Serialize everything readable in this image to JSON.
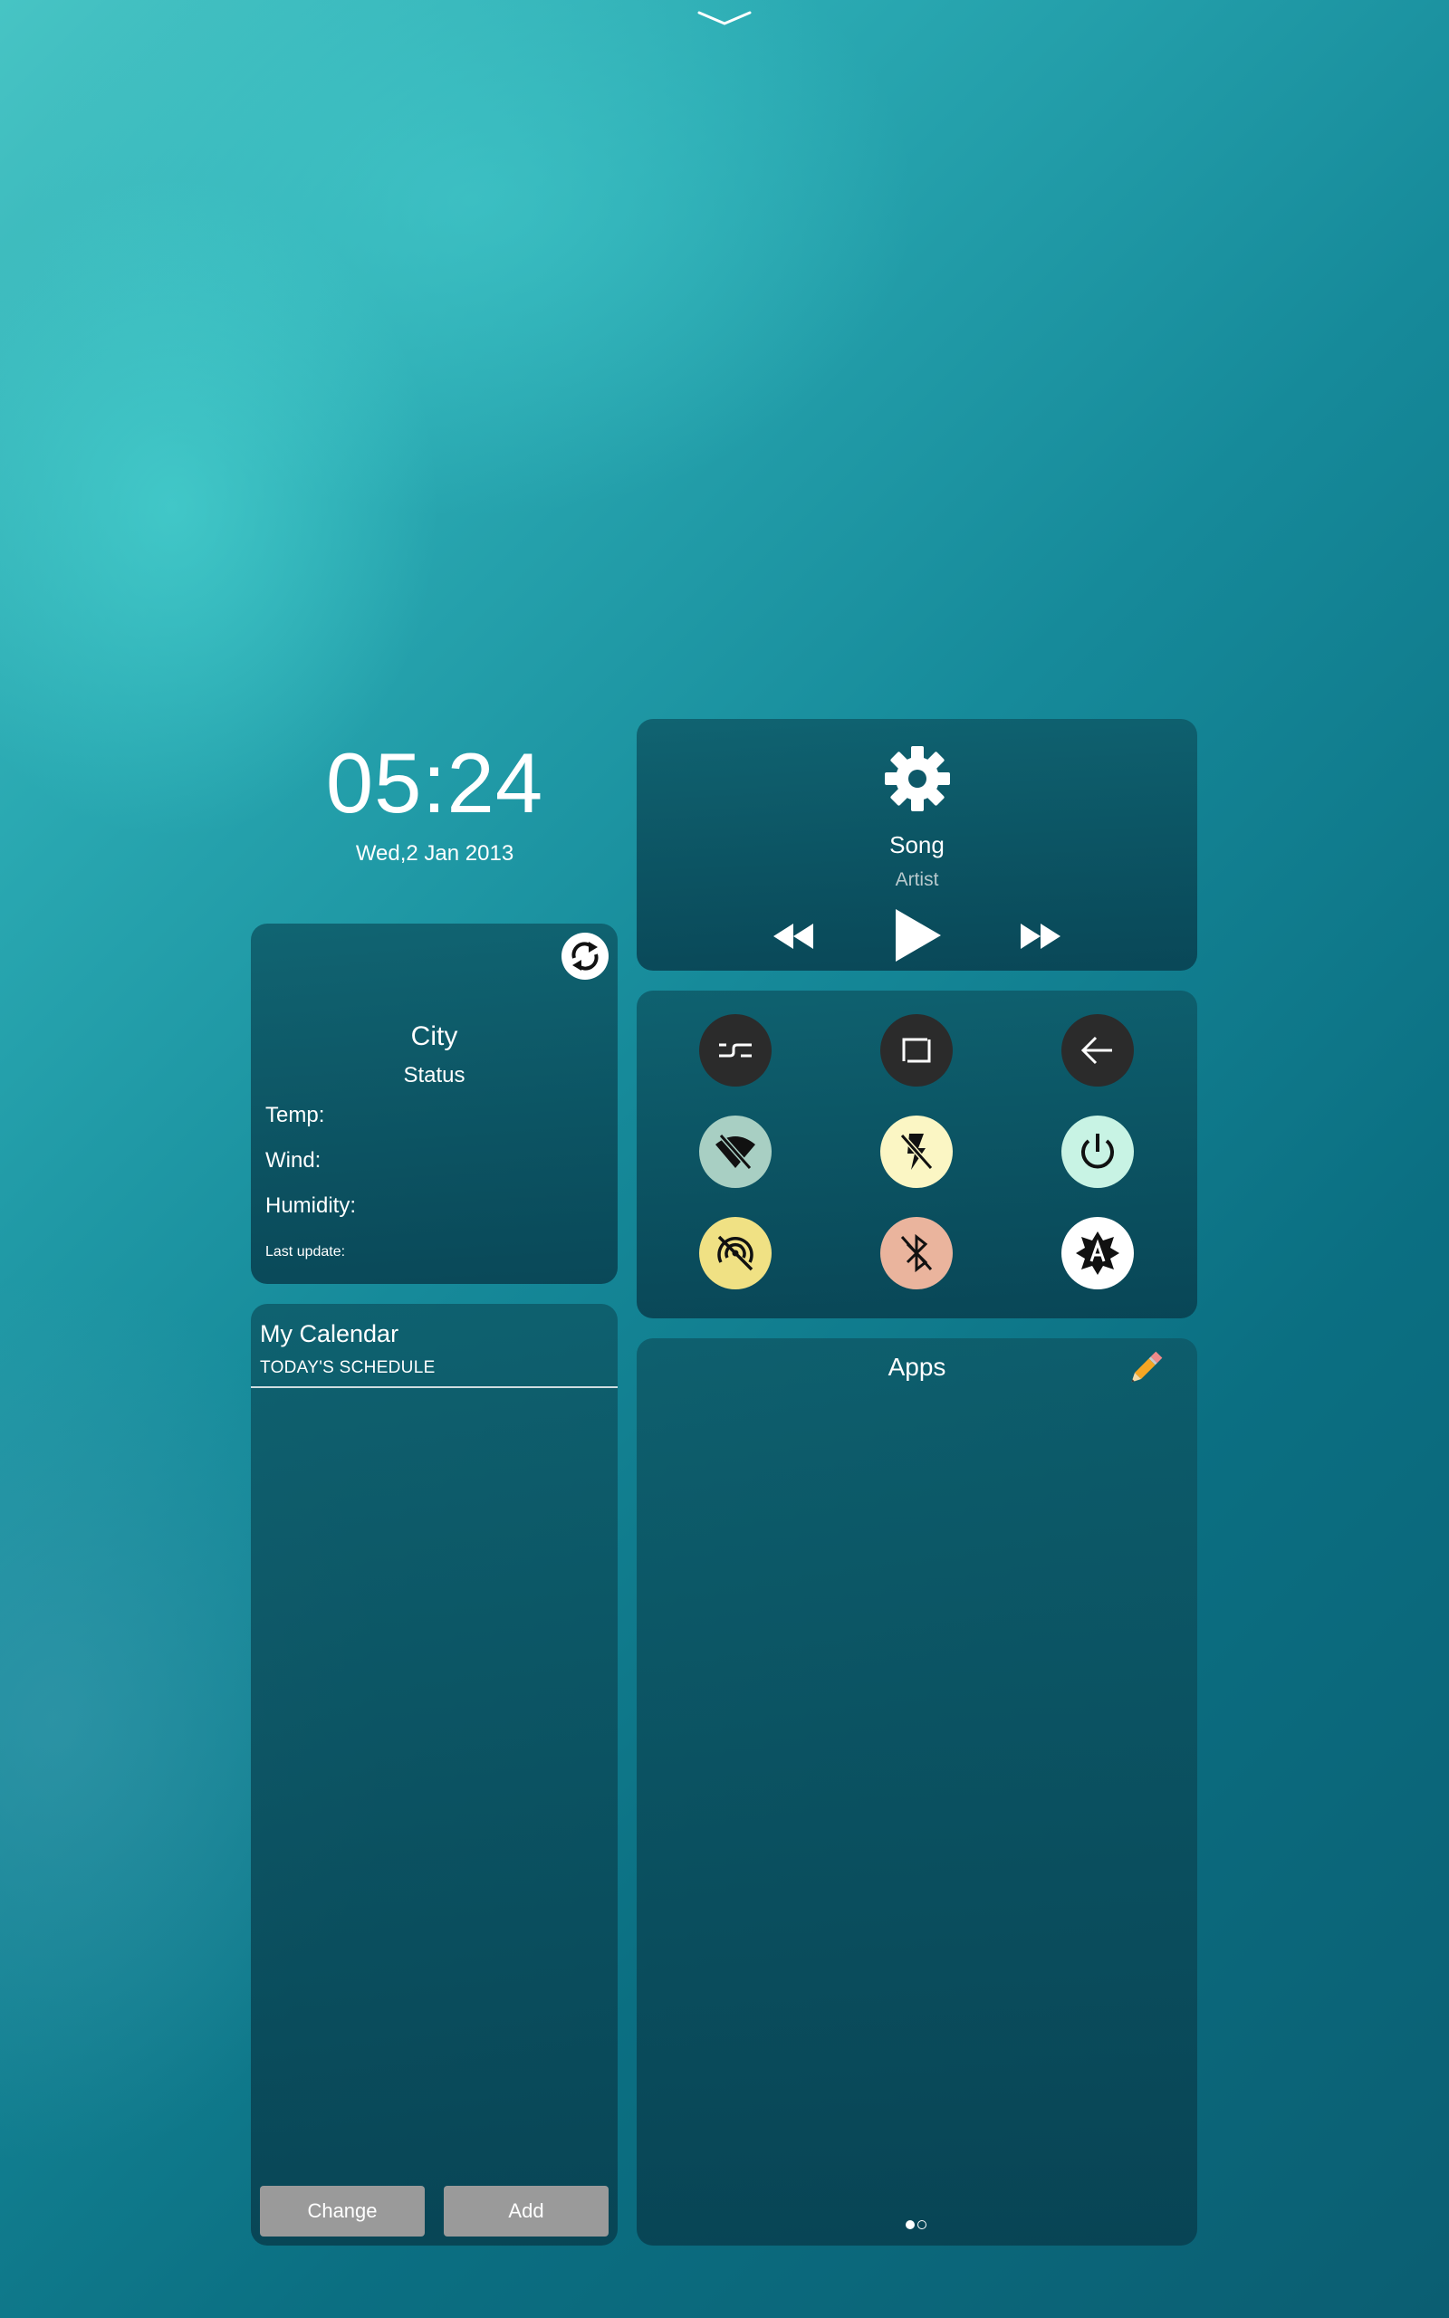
{
  "clock": {
    "time": "05:24",
    "date": "Wed,2 Jan 2013"
  },
  "weather": {
    "city": "City",
    "status": "Status",
    "temp_label": "Temp:",
    "wind_label": "Wind:",
    "humidity_label": "Humidity:",
    "last_update_label": "Last update:"
  },
  "calendar": {
    "title": "My Calendar",
    "subtitle": "TODAY'S SCHEDULE",
    "change_label": "Change",
    "add_label": "Add"
  },
  "music": {
    "song": "Song",
    "artist": "Artist"
  },
  "toggles": [
    {
      "icon": "recents-icon",
      "color": "#2b2b2b",
      "state": "dark"
    },
    {
      "icon": "home-icon",
      "color": "#2b2b2b",
      "state": "dark"
    },
    {
      "icon": "back-icon",
      "color": "#2b2b2b",
      "state": "dark"
    },
    {
      "icon": "wifi-off-icon",
      "color": "#a8cfc3",
      "state": "off"
    },
    {
      "icon": "flash-off-icon",
      "color": "#fbf6c4",
      "state": "off"
    },
    {
      "icon": "power-icon",
      "color": "#c8f3e4",
      "state": "on"
    },
    {
      "icon": "hotspot-off-icon",
      "color": "#f0e184",
      "state": "off"
    },
    {
      "icon": "bluetooth-off-icon",
      "color": "#eab49d",
      "state": "off"
    },
    {
      "icon": "auto-brightness-icon",
      "color": "#ffffff",
      "state": "on"
    }
  ],
  "apps": {
    "title": "Apps",
    "page_count": 2,
    "current_page": 1
  }
}
